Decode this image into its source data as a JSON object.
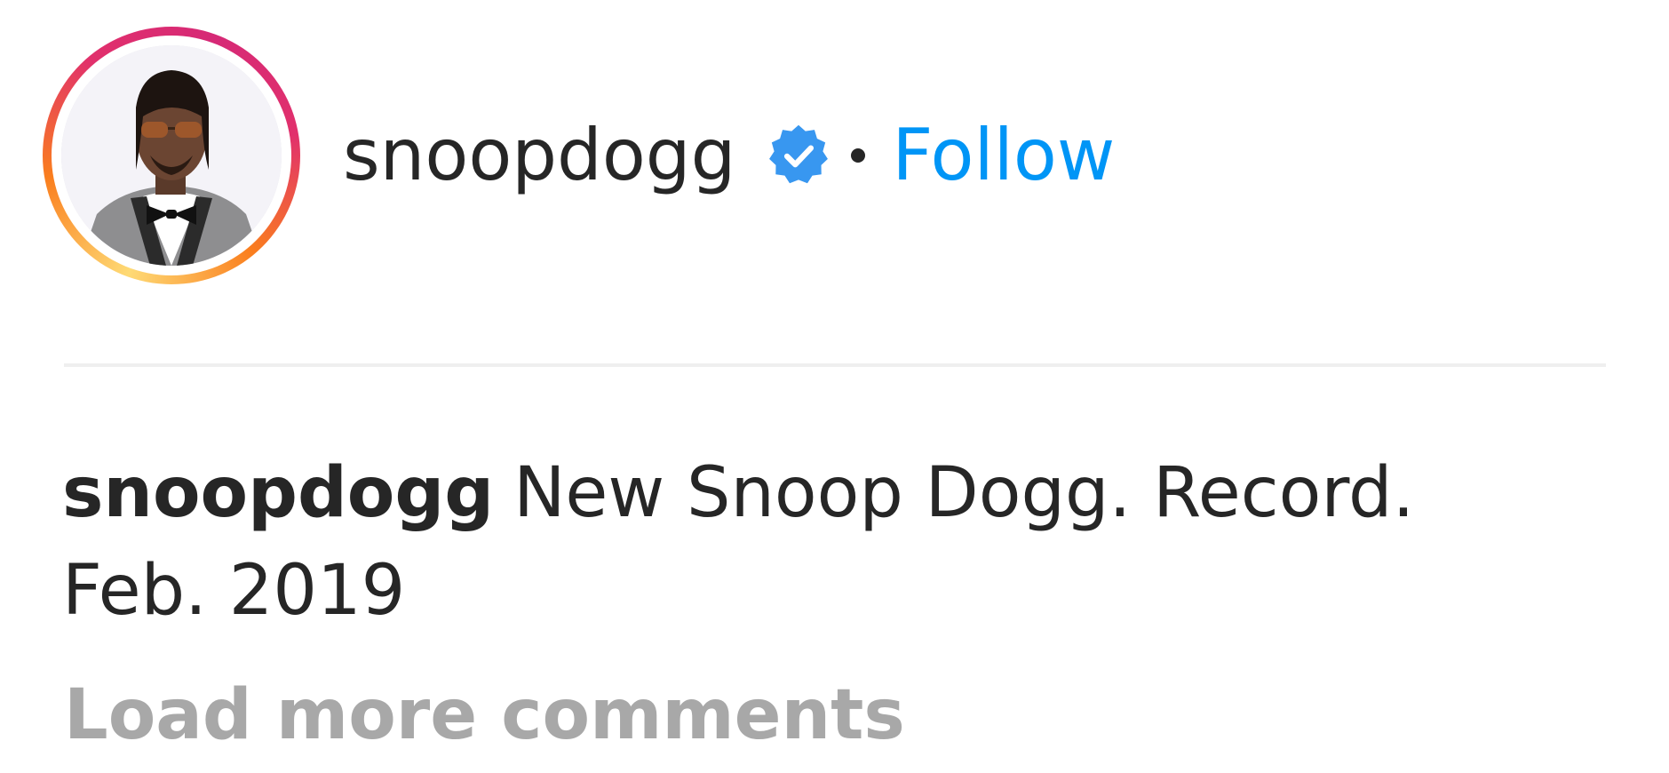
{
  "post_header": {
    "username": "snoopdogg",
    "separator": "•",
    "follow_label": "Follow",
    "icons": {
      "avatar": "profile-picture",
      "verified": "verified-badge-icon"
    },
    "colors": {
      "follow": "#0095f6",
      "verified": "#3897f0",
      "story_ring_start": "#feda75",
      "story_ring_end": "#d62976"
    }
  },
  "caption": {
    "username": "snoopdogg",
    "text": "New Snoop Dogg. Record. Feb. 2019"
  },
  "comments": {
    "load_more_label": "Load more comments"
  }
}
